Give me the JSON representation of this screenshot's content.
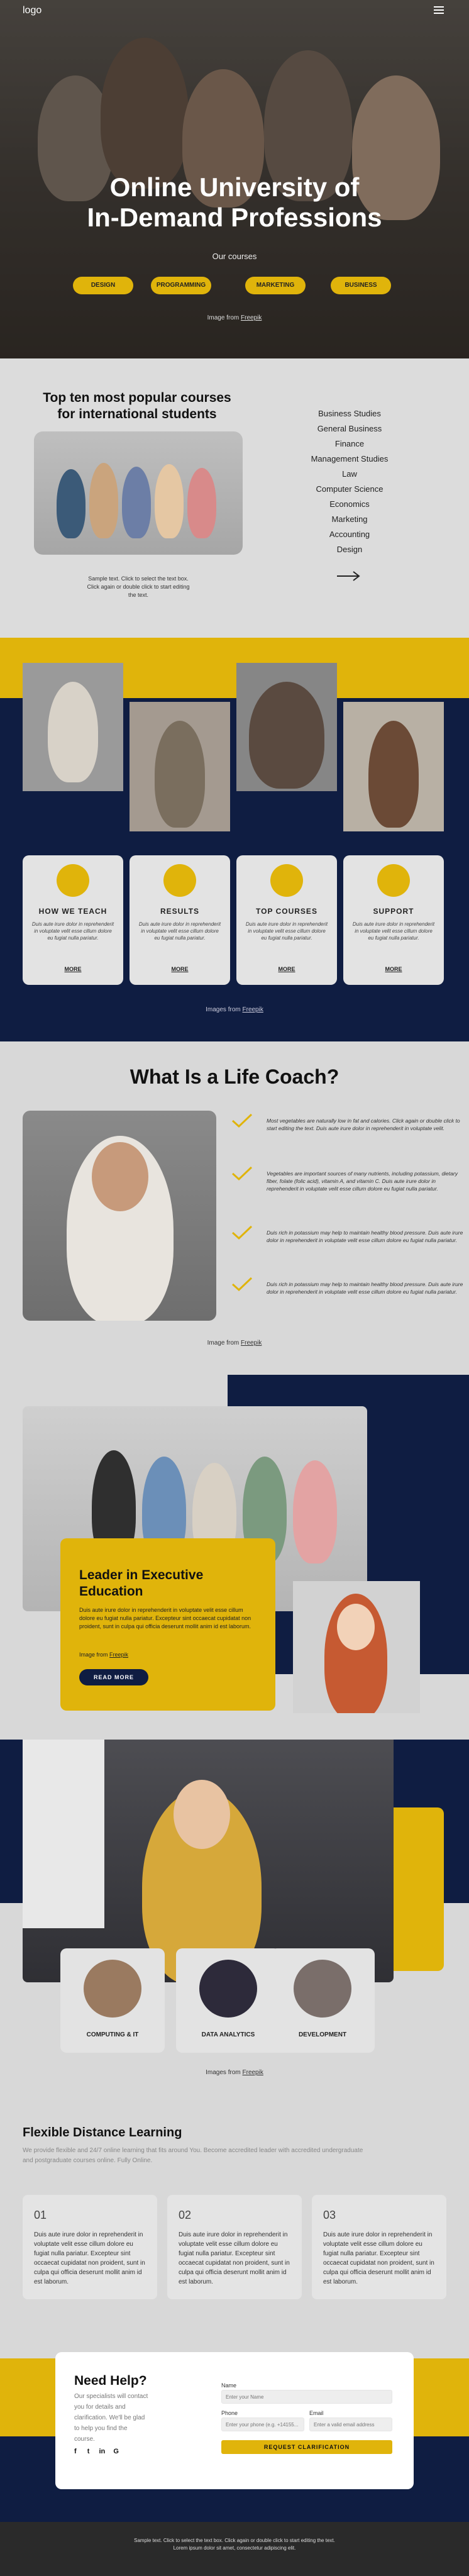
{
  "header": {
    "logo": "logo"
  },
  "hero": {
    "title_line1": "Online University of",
    "title_line2": "In-Demand Professions",
    "subtitle": "Our courses",
    "pills": [
      "DESIGN",
      "PROGRAMMING",
      "MARKETING",
      "BUSINESS"
    ],
    "credit_prefix": "Image from ",
    "credit_link": "Freepik"
  },
  "top_courses": {
    "title_line1": "Top ten most popular courses",
    "title_line2": "for international students",
    "caption_lines": [
      "Sample text. Click to select the text box.",
      "Click again or double click to start editing",
      "the text."
    ],
    "list": [
      "Business Studies",
      "General Business",
      "Finance",
      "Management Studies",
      "Law",
      "Computer Science",
      "Economics",
      "Marketing",
      "Accounting",
      "Design"
    ]
  },
  "features": {
    "cards": [
      {
        "title": "HOW WE TEACH",
        "text": "Duis aute irure dolor in reprehenderit in voluptate velit esse cillum dolore eu fugiat nulla pariatur.",
        "more": "MORE"
      },
      {
        "title": "RESULTS",
        "text": "Duis aute irure dolor in reprehenderit in voluptate velit esse cillum dolore eu fugiat nulla pariatur.",
        "more": "MORE"
      },
      {
        "title": "TOP COURSES",
        "text": "Duis aute irure dolor in reprehenderit in voluptate velit esse cillum dolore eu fugiat nulla pariatur.",
        "more": "MORE"
      },
      {
        "title": "SUPPORT",
        "text": "Duis aute irure dolor in reprehenderit in voluptate velit esse cillum dolore eu fugiat nulla pariatur.",
        "more": "MORE"
      }
    ],
    "credit_prefix": "Images from ",
    "credit_link": "Freepik"
  },
  "life_coach": {
    "title": "What Is a Life Coach?",
    "items": [
      "Most vegetables are naturally low in fat and calories. Click again or double click to start editing the text. Duis aute irure dolor in reprehenderit in voluptate velit.",
      "Vegetables are important sources of many nutrients, including potassium, dietary fiber, folate (folic acid), vitamin A, and vitamin C. Duis aute irure dolor in reprehenderit in voluptate velit esse cillum dolore eu fugiat nulla pariatur.",
      "Duis rich in potassium may help to maintain healthy blood pressure. Duis aute irure dolor in reprehenderit in voluptate velit esse cillum dolore eu fugiat nulla pariatur.",
      "Duis rich in potassium may help to maintain healthy blood pressure. Duis aute irure dolor in reprehenderit in voluptate velit esse cillum dolore eu fugiat nulla pariatur."
    ],
    "credit_prefix": "Image from ",
    "credit_link": "Freepik"
  },
  "leader": {
    "title_line1": "Leader in Executive",
    "title_line2": "Education",
    "text": "Duis aute irure dolor in reprehenderit in voluptate velit esse cillum dolore eu fugiat nulla pariatur. Excepteur sint occaecat cupidatat non proident, sunt in culpa qui officia deserunt mollit anim id est laborum.",
    "credit_prefix": "Image from ",
    "credit_link": "Freepik",
    "button": "READ MORE"
  },
  "categories": {
    "items": [
      "COMPUTING & IT",
      "DATA ANALYTICS",
      "DEVELOPMENT"
    ],
    "credit_prefix": "Images from ",
    "credit_link": "Freepik"
  },
  "distance": {
    "title": "Flexible Distance Learning",
    "intro": "We provide flexible and 24/7 online learning that fits around You. Become accredited leader with accredited undergraduate and postgraduate courses online. Fully Online.",
    "cards": [
      {
        "num": "01",
        "text": "Duis aute irure dolor in reprehenderit in voluptate velit esse cillum dolore eu fugiat nulla pariatur. Excepteur sint occaecat cupidatat non proident, sunt in culpa qui officia deserunt mollit anim id est laborum."
      },
      {
        "num": "02",
        "text": "Duis aute irure dolor in reprehenderit in voluptate velit esse cillum dolore eu fugiat nulla pariatur. Excepteur sint occaecat cupidatat non proident, sunt in culpa qui officia deserunt mollit anim id est laborum."
      },
      {
        "num": "03",
        "text": "Duis aute irure dolor in reprehenderit in voluptate velit esse cillum dolore eu fugiat nulla pariatur. Excepteur sint occaecat cupidatat non proident, sunt in culpa qui officia deserunt mollit anim id est laborum."
      }
    ]
  },
  "help": {
    "title": "Need Help?",
    "text": "Our specialists will contact you for details and clarification. We'll be glad to help you find the course.",
    "name_label": "Name",
    "name_placeholder": "Enter your Name",
    "phone_label": "Phone",
    "phone_placeholder": "Enter your phone (e.g. +14155...",
    "email_label": "Email",
    "email_placeholder": "Enter a valid email address",
    "button": "REQUEST CLARIFICATION",
    "social": [
      "f",
      "t",
      "in",
      "G"
    ]
  },
  "footer": {
    "line1": "Sample text. Click to select the text box. Click again or double click to start editing the text.",
    "line2": "Lorem ipsum dolor sit amet, consectetur adipiscing elit."
  },
  "colors": {
    "accent": "#e0b40b",
    "navy": "#0f1d42",
    "light_gray": "#d8d8d8"
  }
}
